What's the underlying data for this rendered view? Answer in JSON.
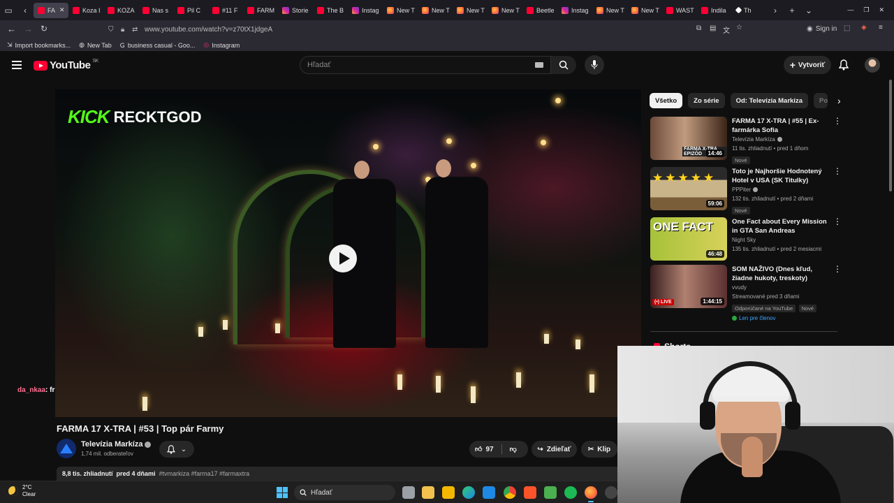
{
  "browser": {
    "tabs": [
      {
        "label": "FA",
        "favicon": "youtube",
        "active": true
      },
      {
        "label": "Koza I",
        "favicon": "youtube"
      },
      {
        "label": "KOZA",
        "favicon": "youtube"
      },
      {
        "label": "Nas s",
        "favicon": "youtube"
      },
      {
        "label": "Pil C",
        "favicon": "youtube"
      },
      {
        "label": "#11 F",
        "favicon": "youtube"
      },
      {
        "label": "FARM",
        "favicon": "youtube"
      },
      {
        "label": "Storie",
        "favicon": "instagram"
      },
      {
        "label": "The B",
        "favicon": "youtube"
      },
      {
        "label": "Instag",
        "favicon": "instagram"
      },
      {
        "label": "New T",
        "favicon": "firefox"
      },
      {
        "label": "New T",
        "favicon": "firefox"
      },
      {
        "label": "New T",
        "favicon": "firefox"
      },
      {
        "label": "New T",
        "favicon": "firefox"
      },
      {
        "label": "Beetle",
        "favicon": "youtube"
      },
      {
        "label": "Instag",
        "favicon": "instagram"
      },
      {
        "label": "New T",
        "favicon": "firefox"
      },
      {
        "label": "New T",
        "favicon": "firefox"
      },
      {
        "label": "WAST",
        "favicon": "youtube"
      },
      {
        "label": "Indila",
        "favicon": "youtube"
      },
      {
        "label": "Th",
        "favicon": "other"
      }
    ],
    "url": "www.youtube.com/watch?v=z70tX1jdgeA",
    "sign_in_label": "Sign in",
    "bookmarks": [
      {
        "label": "Import bookmarks...",
        "icon": "import-icon"
      },
      {
        "label": "New Tab",
        "icon": "globe-icon"
      },
      {
        "label": "business casual - Goo...",
        "icon": "google-icon"
      },
      {
        "label": "Instagram",
        "icon": "instagram-icon"
      }
    ]
  },
  "youtube": {
    "logo_text": "YouTube",
    "country_code": "SK",
    "search_placeholder": "Hľadať",
    "create_label": "Vytvoriť"
  },
  "video": {
    "overlay_logo": "KICK",
    "overlay_channel": "RECKTGOD",
    "chat_user": "da_nkaa",
    "chat_text": ": fr",
    "title": "FARMA 17 X-TRA | #53 | Top pár Farmy",
    "channel_name": "Televízia Markíza",
    "subscribers": "1,74 mil. odberateľov",
    "likes": "97",
    "share_label": "Zdieľať",
    "clip_label": "Klip",
    "views": "8,8 tis. zhliadnutí",
    "age": "pred 4 dňami",
    "hashtags": "#tvmarkiza #farma17 #farmaxtra"
  },
  "chips": [
    "Všetko",
    "Zo série",
    "Od: Televízia Markíza",
    "Po"
  ],
  "recommendations": [
    {
      "title": "FARMA 17 X-TRA | #55 | Ex-farmárka Sofia",
      "channel": "Televízia Markíza",
      "verified": true,
      "stats": "11 tis. zhliadnutí • pred 1 dňom",
      "duration": "14:46",
      "badge": "Nové",
      "thumb_text": "FARMA X-TRA EPIZÓD"
    },
    {
      "title": "Toto je Najhoršie Hodnotený Hotel v USA (SK Titulky)",
      "channel": "PPPiter",
      "verified": true,
      "stats": "132 tis. zhliadnutí • pred 2 dňami",
      "duration": "59:06",
      "badge": "Nové",
      "thumb_text": ""
    },
    {
      "title": "One Fact about Every Mission in GTA San Andreas",
      "channel": "Night Sky",
      "verified": false,
      "stats": "135 tis. zhliadnutí • pred 2 mesiacmi",
      "duration": "46:48",
      "badge": "",
      "thumb_text": "ONE FACT"
    },
    {
      "title": "SOM NAŽIVO (Dnes kľud, žiadne hukoty, treskoty)",
      "channel": "vvudy",
      "verified": false,
      "stats": "Streamované pred 3 dňami",
      "duration": "1:44:15",
      "live_label": "(•) LIVE",
      "badge": "Odporúčané na YouTube",
      "badge2": "Nové",
      "members_label": "Len pre členov",
      "thumb_text": ""
    }
  ],
  "shorts_label": "Shorts",
  "taskbar": {
    "temperature": "2°C",
    "condition": "Clear",
    "search_label": "Hľadať"
  }
}
